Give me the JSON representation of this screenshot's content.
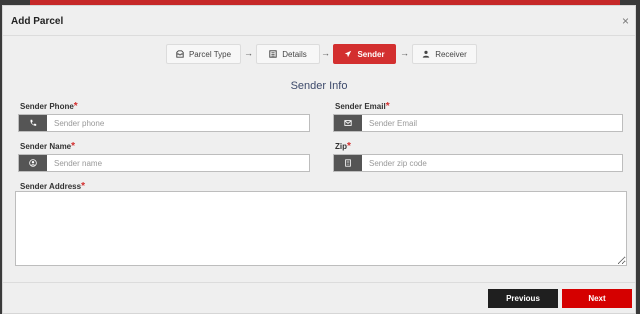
{
  "modal": {
    "title": "Add Parcel",
    "close_symbol": "×"
  },
  "steps": [
    {
      "label": "Parcel Type",
      "icon": "inbox-icon",
      "active": false
    },
    {
      "label": "Details",
      "icon": "list-icon",
      "active": false
    },
    {
      "label": "Sender",
      "icon": "paper-plane-icon",
      "active": true
    },
    {
      "label": "Receiver",
      "icon": "user-icon",
      "active": false
    }
  ],
  "step_arrow": "→",
  "section_title": "Sender Info",
  "fields": {
    "phone": {
      "label": "Sender Phone",
      "required": "*",
      "placeholder": "Sender phone",
      "icon": "phone-icon",
      "value": ""
    },
    "email": {
      "label": "Sender Email",
      "required": "*",
      "placeholder": "Sender Email",
      "icon": "envelope-icon",
      "value": ""
    },
    "name": {
      "label": "Sender Name",
      "required": "*",
      "placeholder": "Sender name",
      "icon": "user-circle-icon",
      "value": ""
    },
    "zip": {
      "label": "Zip",
      "required": "*",
      "placeholder": "Sender zip code",
      "icon": "building-icon",
      "value": ""
    },
    "address": {
      "label": "Sender Address",
      "required": "*",
      "value": ""
    }
  },
  "buttons": {
    "previous": "Previous",
    "next": "Next"
  },
  "colors": {
    "accent": "#d32f2f",
    "next_button": "#d50000",
    "previous_button": "#1f1f1f",
    "addon": "#555555",
    "section_title": "#3d4a6b"
  }
}
